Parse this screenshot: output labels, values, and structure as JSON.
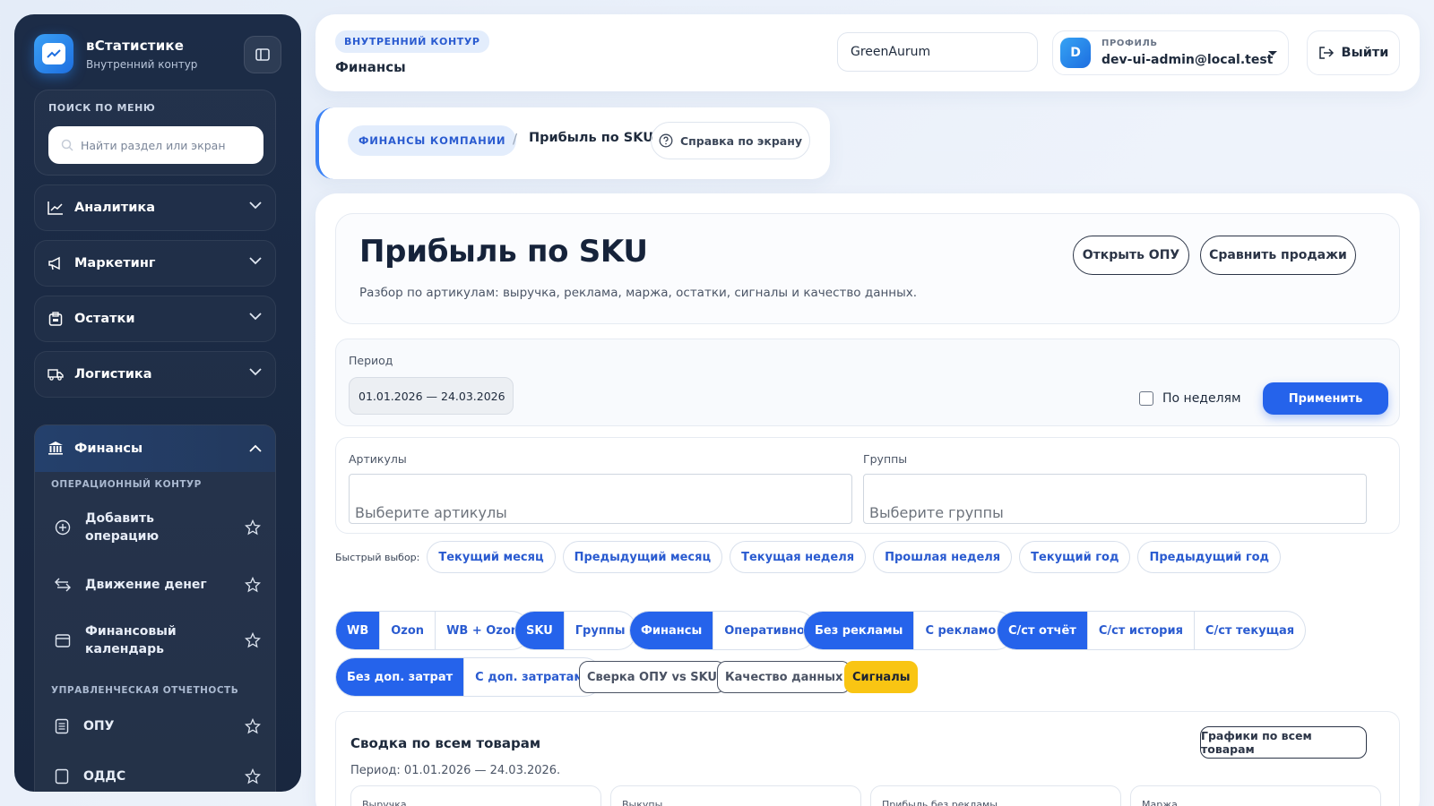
{
  "sidebar": {
    "brand_title": "вСтатистике",
    "brand_subtitle": "Внутренний контур",
    "search_label": "ПОИСК ПО МЕНЮ",
    "search_placeholder": "Найти раздел или экран",
    "nav": [
      {
        "label": "Аналитика",
        "icon": "chart-line-icon"
      },
      {
        "label": "Маркетинг",
        "icon": "megaphone-icon"
      },
      {
        "label": "Остатки",
        "icon": "box-icon"
      },
      {
        "label": "Логистика",
        "icon": "truck-icon"
      }
    ],
    "finance": {
      "label": "Финансы",
      "icon": "bank-icon",
      "section_operational": "ОПЕРАЦИОННЫЙ КОНТУР",
      "section_management": "УПРАВЛЕНЧЕСКАЯ ОТЧЕТНОСТЬ",
      "items": [
        {
          "label": "Добавить операцию",
          "icon": "plus-circle-icon"
        },
        {
          "label": "Движение денег",
          "icon": "arrows-exchange-icon"
        },
        {
          "label": "Финансовый календарь",
          "icon": "calendar-icon"
        },
        {
          "label": "ОПУ",
          "icon": "document-icon"
        },
        {
          "label": "ОДДС",
          "icon": "document-icon"
        }
      ]
    }
  },
  "header": {
    "context_pill": "ВНУТРЕННИЙ КОНТУР",
    "title": "Финансы",
    "company": "GreenAurum",
    "profile_caption": "ПРОФИЛЬ",
    "avatar_letter": "D",
    "email": "dev-ui-admin@local.test",
    "logout_label": "Выйти"
  },
  "breadcrumb": {
    "parent": "ФИНАНСЫ КОМПАНИИ",
    "separator": "/",
    "current": "Прибыль по SKU",
    "help_label": "Справка по экрану"
  },
  "page": {
    "title": "Прибыль по SKU",
    "description": "Разбор по артикулам: выручка, реклама, маржа, остатки, сигналы и качество данных.",
    "open_pnl_label": "Открыть ОПУ",
    "compare_sales_label": "Сравнить продажи"
  },
  "period": {
    "label": "Период",
    "value": "01.01.2026 — 24.03.2026",
    "weekly_label": "По неделям",
    "weekly_checked": false,
    "apply_label": "Применить"
  },
  "filters": {
    "articles_label": "Артикулы",
    "articles_placeholder": "Выберите артикулы",
    "groups_label": "Группы",
    "groups_placeholder": "Выберите группы"
  },
  "quick": {
    "caption": "Быстрый выбор:",
    "chips": [
      "Текущий месяц",
      "Предыдущий месяц",
      "Текущая неделя",
      "Прошлая неделя",
      "Текущий год",
      "Предыдущий год"
    ]
  },
  "segments": {
    "marketplace": [
      "WB",
      "Ozon",
      "WB + Ozon"
    ],
    "grouping": [
      "SKU",
      "Группы"
    ],
    "mode": [
      "Финансы",
      "Оперативно"
    ],
    "ads": [
      "Без рекламы",
      "С рекламой"
    ],
    "cost": [
      "С/ст отчёт",
      "С/ст история",
      "С/ст текущая"
    ],
    "extra": [
      "Без доп. затрат",
      "С доп. затратами"
    ],
    "tags": [
      "Сверка ОПУ vs SKU",
      "Качество данных",
      "Сигналы"
    ]
  },
  "summary": {
    "title": "Сводка по всем товарам",
    "period_text": "Период: 01.01.2026 — 24.03.2026.",
    "charts_label": "Графики по всем товарам",
    "metrics": [
      "Выручка",
      "Выкупы",
      "Прибыль без рекламы",
      "Маржа"
    ]
  },
  "colors": {
    "accent": "#2563eb",
    "sidebar_bg": "#1c2c47",
    "signal": "#f9c513"
  }
}
